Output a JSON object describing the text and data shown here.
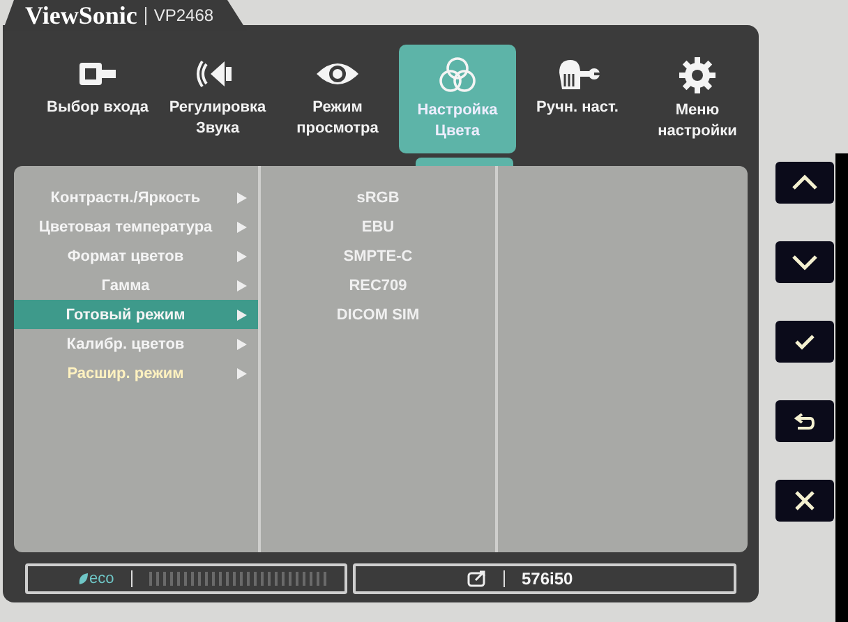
{
  "header": {
    "brand": "ViewSonic",
    "model": "VP2468"
  },
  "menu": [
    {
      "label": "Выбор входа",
      "selected": false
    },
    {
      "label": "Регулировка Звука",
      "selected": false
    },
    {
      "label": "Режим просмотра",
      "selected": false
    },
    {
      "label": "Настройка Цвета",
      "selected": true
    },
    {
      "label": "Ручн. наст.",
      "selected": false
    },
    {
      "label": "Меню настройки",
      "selected": false
    }
  ],
  "submenu": [
    {
      "label": "Контрастн./Яркость",
      "selected": false,
      "disabled": false
    },
    {
      "label": "Цветовая температура",
      "selected": false,
      "disabled": false
    },
    {
      "label": "Формат цветов",
      "selected": false,
      "disabled": false
    },
    {
      "label": "Гамма",
      "selected": false,
      "disabled": false
    },
    {
      "label": "Готовый режим",
      "selected": true,
      "disabled": false
    },
    {
      "label": "Калибр. цветов",
      "selected": false,
      "disabled": false
    },
    {
      "label": "Расшир. режим",
      "selected": false,
      "disabled": true
    }
  ],
  "options": [
    "sRGB",
    "EBU",
    "SMPTE-C",
    "REC709",
    "DICOM SIM"
  ],
  "status_bar": {
    "eco": "eco",
    "resolution": "576i50"
  },
  "side_buttons": [
    {
      "kind": "up"
    },
    {
      "kind": "down"
    },
    {
      "kind": "confirm"
    },
    {
      "kind": "back"
    },
    {
      "kind": "close"
    }
  ]
}
